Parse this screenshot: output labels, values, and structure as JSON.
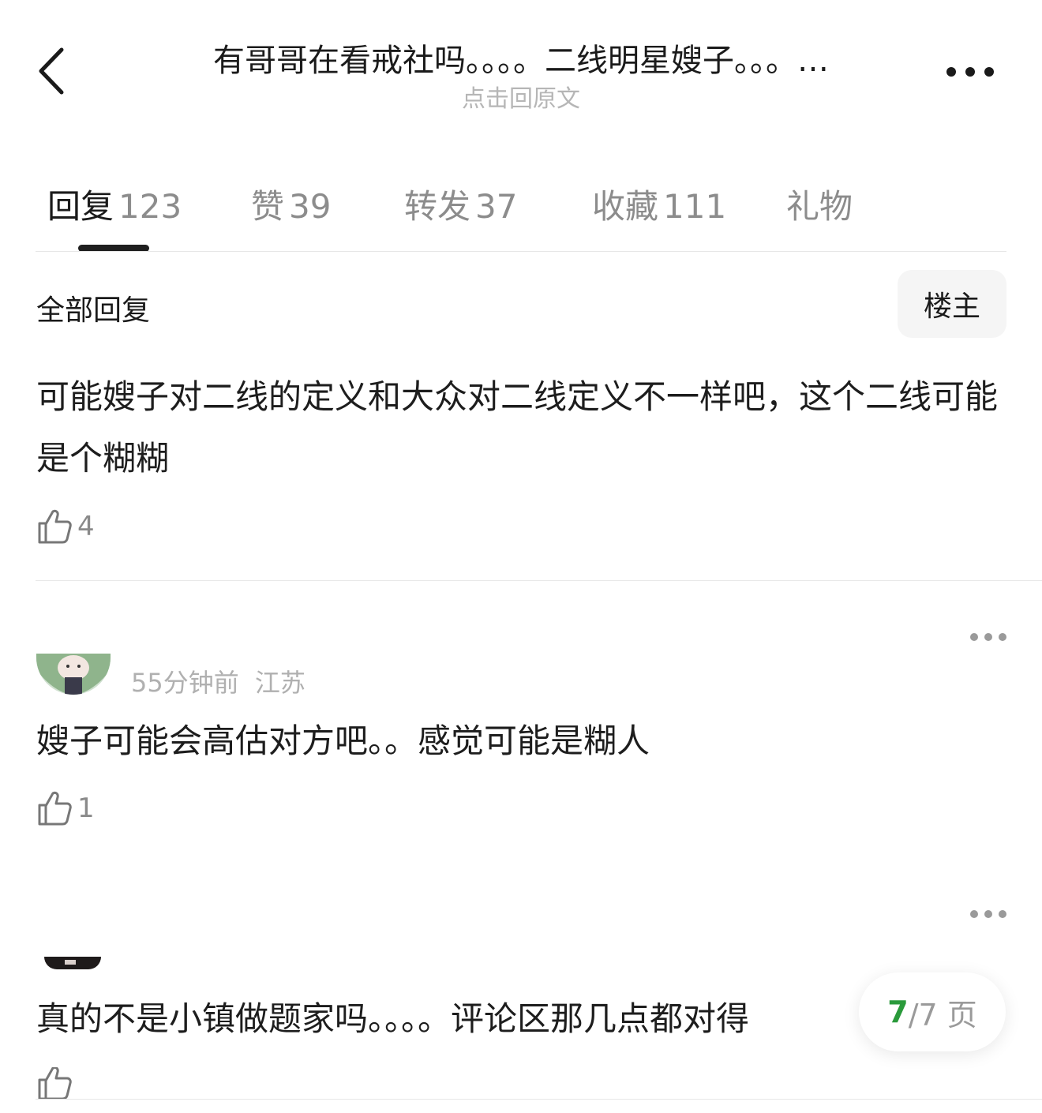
{
  "header": {
    "title": "有哥哥在看戒社吗。。。。二线明星嫂子。。。…",
    "subtitle": "点击回原文"
  },
  "tabs": [
    {
      "label": "回复",
      "count": "123"
    },
    {
      "label": "赞",
      "count": "39"
    },
    {
      "label": "转发",
      "count": "37"
    },
    {
      "label": "收藏",
      "count": "111"
    },
    {
      "label": "礼物",
      "count": ""
    }
  ],
  "section": {
    "title": "全部回复",
    "op_button": "楼主"
  },
  "comments": [
    {
      "text": "可能嫂子对二线的定义和大众对二线定义不一样吧，这个二线可能是个糊糊",
      "likes": "4"
    },
    {
      "time": "55分钟前",
      "location": "江苏",
      "text": "嫂子可能会高估对方吧。。感觉可能是糊人",
      "likes": "1"
    },
    {
      "text": "真的不是小镇做题家吗。。。。评论区那几点都对得",
      "likes": ""
    }
  ],
  "pagination": {
    "current": "7",
    "total_text": "/7 页"
  },
  "icons": {
    "back": "chevron-left-icon",
    "more": "more-horizontal-icon",
    "like": "thumbs-up-icon"
  },
  "colors": {
    "accent_green": "#2a9a3b",
    "muted_text": "#8c8c8c"
  }
}
